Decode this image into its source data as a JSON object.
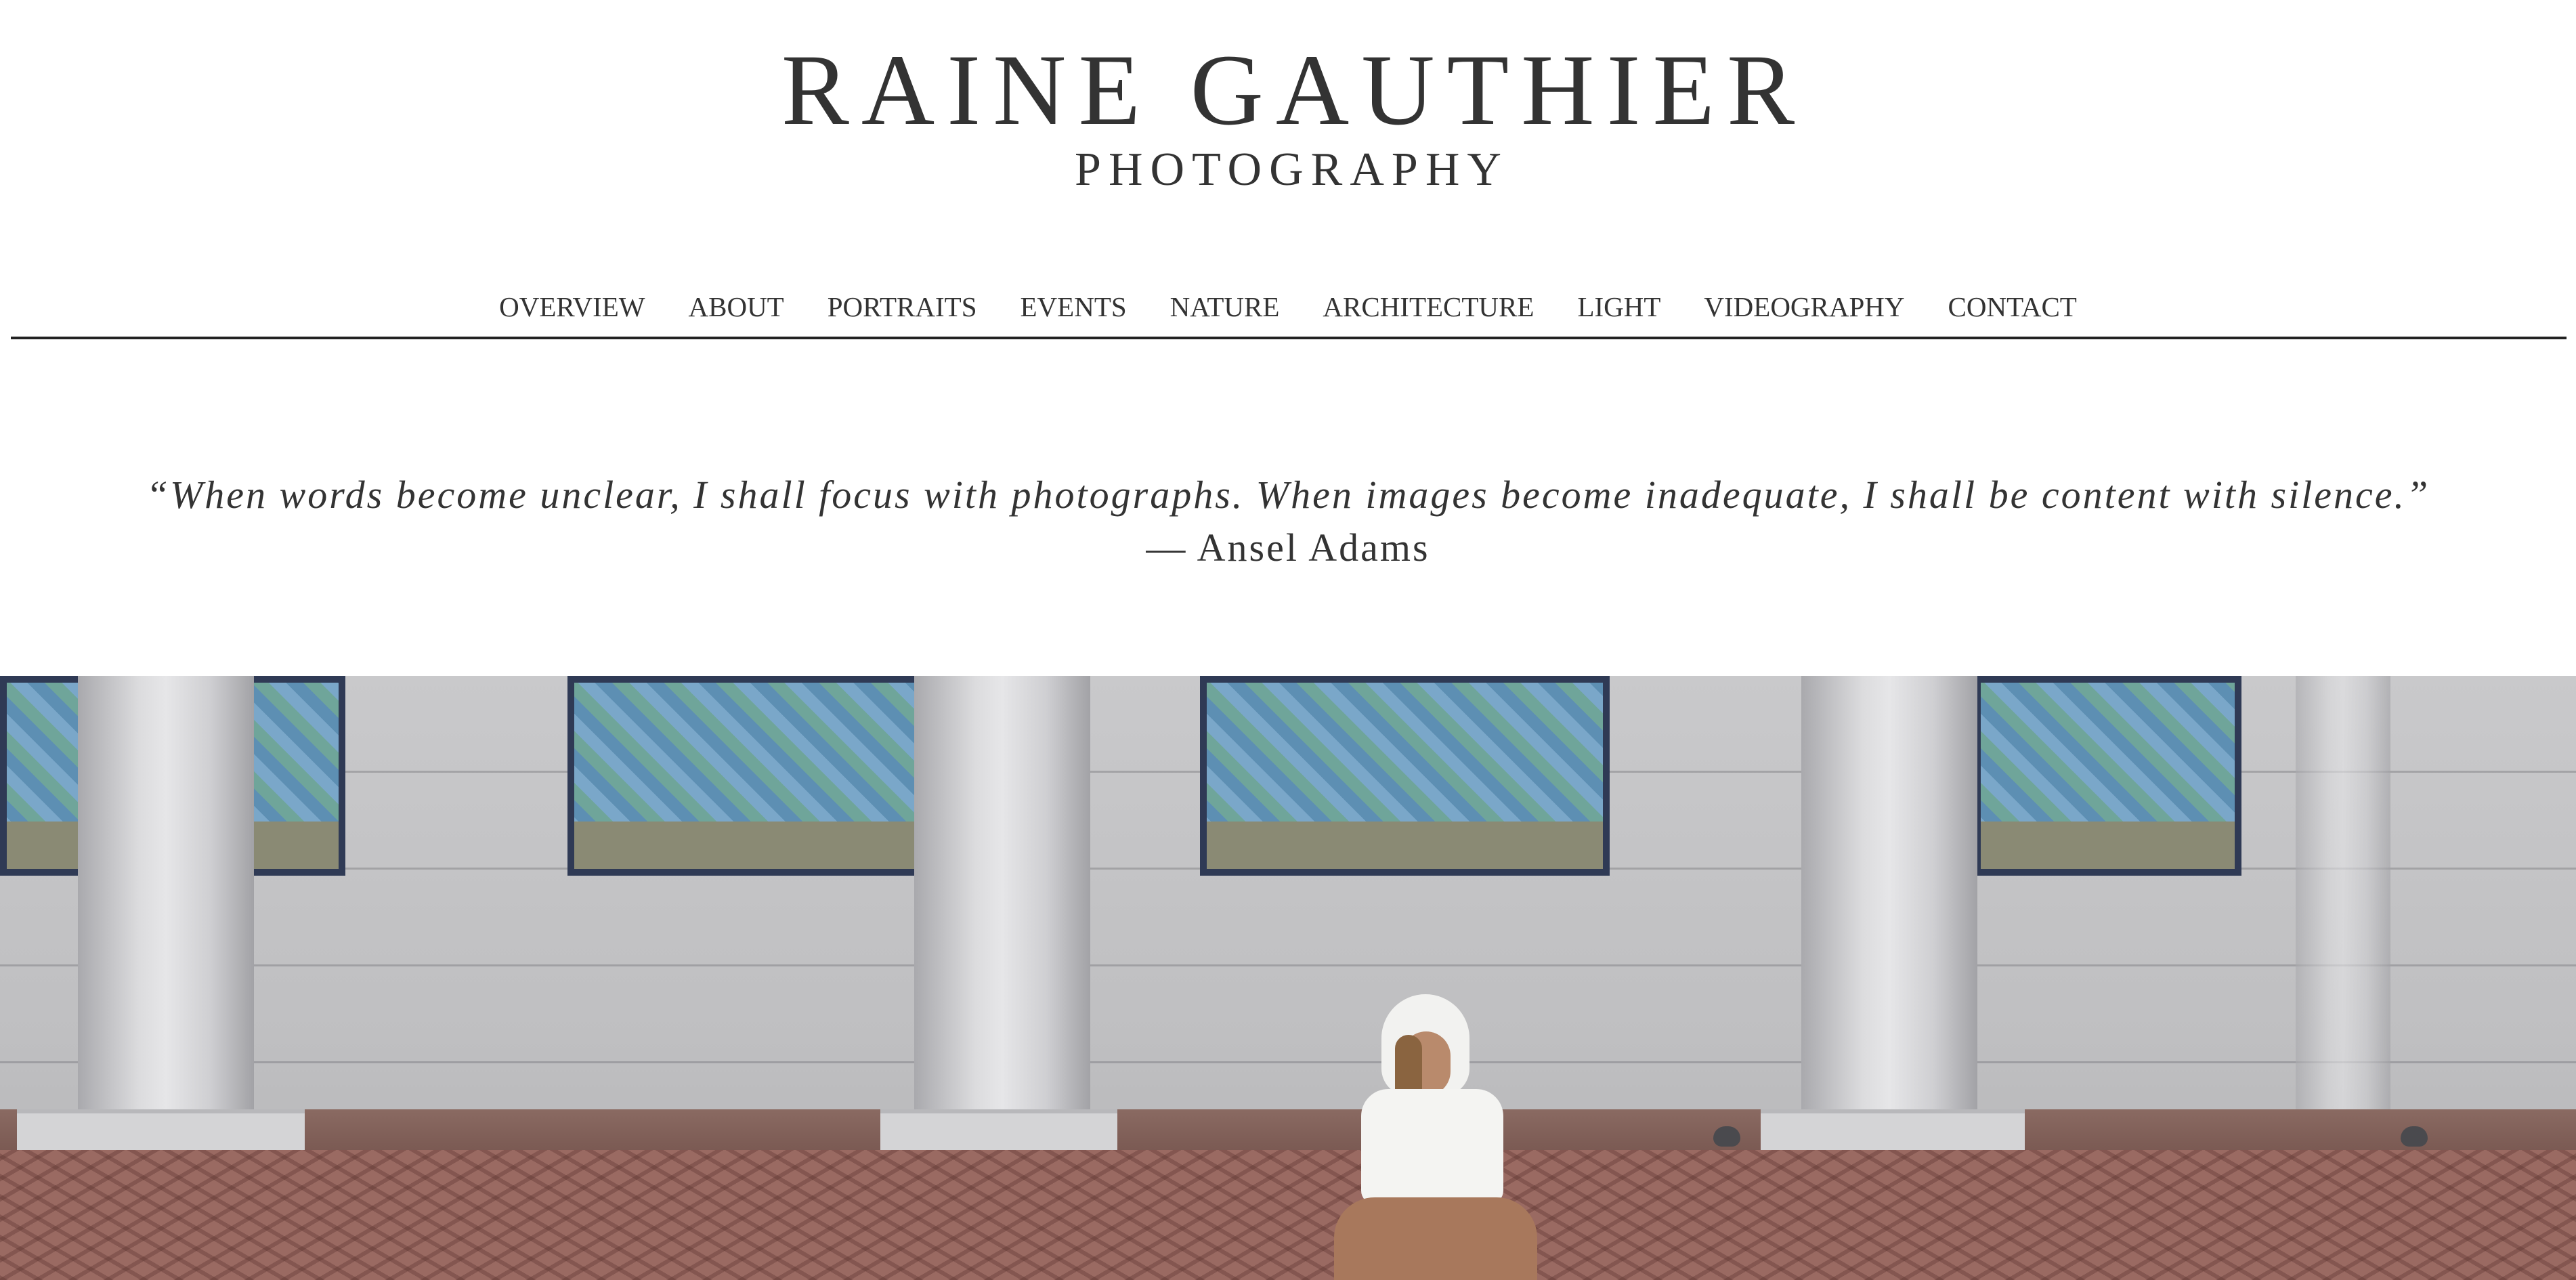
{
  "header": {
    "title": "RAINE GAUTHIER",
    "subtitle": "PHOTOGRAPHY"
  },
  "nav": {
    "items": [
      "OVERVIEW",
      "ABOUT",
      "PORTRAITS",
      "EVENTS",
      "NATURE",
      "ARCHITECTURE",
      "LIGHT",
      "VIDEOGRAPHY",
      "CONTACT"
    ]
  },
  "quote": {
    "text": "“When words become unclear, I shall focus with photographs. When images become inadequate, I shall be content with silence.”",
    "author": "— Ansel Adams"
  },
  "colors": {
    "text": "#333333",
    "rule": "#222222",
    "background": "#ffffff"
  }
}
